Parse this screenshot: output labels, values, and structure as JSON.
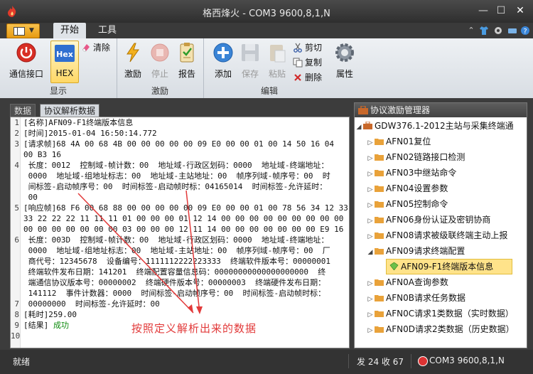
{
  "window": {
    "title": "格西烽火 - COM3  9600,8,1,N"
  },
  "ribbon": {
    "tabs": [
      {
        "label": "开始"
      },
      {
        "label": "工具"
      }
    ],
    "groups": {
      "display": {
        "label": "显示",
        "connect": "通信接口",
        "hex_icon": "Hex",
        "hex": "HEX",
        "clear": "清除"
      },
      "stimulus": {
        "label": "激励",
        "excite": "激励",
        "stop": "停止",
        "report": "报告"
      },
      "edit": {
        "label": "编辑",
        "add": "添加",
        "save": "保存",
        "paste": "粘贴",
        "cut": "剪切",
        "copy": "复制",
        "delete": "删除",
        "props": "属性"
      }
    }
  },
  "left_tabs": [
    {
      "label": "数据"
    },
    {
      "label": "协议解析数据"
    }
  ],
  "editor": {
    "line_numbers": [
      "1",
      "2",
      "3",
      "4",
      "5",
      "6",
      "7",
      "8",
      "9",
      "10"
    ],
    "lines": [
      "[名称]AFN09-F1终端版本信息",
      "[时间]2015-01-04 16:50:14.772",
      "[请求帧]68 4A 00 68 4B 00 00 00 00 00 09 E0 00 00 01 00 14 50 16 04",
      "00 B3 16",
      " 长度：0012  控制域-帧计数：00  地址域-行政区划码：0000  地址域-终端地址：",
      " 0000  地址域-组地址标志：00  地址域-主站地址：00  帧序列域-帧序号：00  时",
      " 间标签-启动帧序号：00  时间标签-启动帧时标：04165014  时间标签-允许延时：",
      " 00",
      "[响应帧]68 F6 00 68 88 00 00 00 00 00 09 E0 00 00 01 00 78 56 34 12 33",
      "33 22 22 22 11 11 11 01 00 00 00 01 12 14 00 00 00 00 00 00 00 00 00",
      "00 00 00 00 00 00 00 03 00 00 00 12 11 14 00 00 00 00 00 00 00 E9 16",
      " 长度：003D  控制域-帧计数：00  地址域-行政区划码：0000  地址域-终端地址：",
      " 0000  地址域-组地址标志：00  地址域-主站地址：00  帧序列域-帧序号：00  厂",
      " 商代号：12345678  设备编号：1111112222223333  终端软件版本号：00000001",
      " 终端软件发布日期：141201  终端配置容量信息码：00000000000000000000  终",
      " 端通信协议版本号：00000002  终端硬件版本号：00000003  终端硬件发布日期：",
      " 141112  事件计数器：0000  时间标签-启动帧序号：00  时间标签-启动帧时标：",
      " 00000000  时间标签-允许延时：00",
      "[耗时]259.00",
      "[结果]"
    ],
    "result_value": "成功",
    "annotation": "按照定义解析出来的数据"
  },
  "stimulus_manager": {
    "title": "协议激励管理器",
    "root": "GDW376.1-2012主站与采集终端通",
    "items": [
      {
        "label": "AFN01复位"
      },
      {
        "label": "AFN02链路接口检测"
      },
      {
        "label": "AFN03中继站命令"
      },
      {
        "label": "AFN04设置参数"
      },
      {
        "label": "AFN05控制命令"
      },
      {
        "label": "AFN06身份认证及密钥协商"
      },
      {
        "label": "AFN08请求被级联终端主动上报"
      },
      {
        "label": "AFN09请求终端配置"
      },
      {
        "label": "AFN09-F1终端版本信息"
      },
      {
        "label": "AFN0A查询参数"
      },
      {
        "label": "AFN0B请求任务数据"
      },
      {
        "label": "AFN0C请求1类数据（实时数据）"
      },
      {
        "label": "AFN0D请求2类数据（历史数据）"
      }
    ]
  },
  "status": {
    "ready": "就绪",
    "counts": "发 24  收 67",
    "port": "COM3  9600,8,1,N"
  },
  "colors": {
    "accent": "#f0a020",
    "ok": "#0a8a0a",
    "annotation": "#e23a3a",
    "selection": "#ffe38a"
  }
}
